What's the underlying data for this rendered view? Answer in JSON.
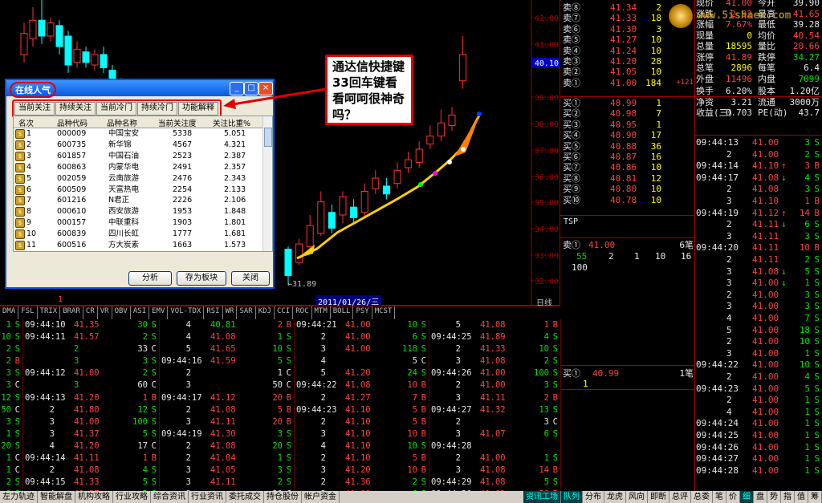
{
  "chart": {
    "price_labels": [
      "42.00",
      "41.00",
      "40.10",
      "39.00",
      "38.00",
      "37.00",
      "36.00",
      "35.00",
      "34.00",
      "33.00",
      "32.00"
    ],
    "low_marker": "←31.89",
    "date_label": "2011/01/26/三",
    "period_label": "日线",
    "marker_one": "1",
    "candles": [
      {
        "o": 40.6,
        "c": 41.4,
        "h": 41.8,
        "l": 40.3
      },
      {
        "o": 41.2,
        "c": 41.9,
        "h": 42.4,
        "l": 40.9
      },
      {
        "o": 41.9,
        "c": 41.3,
        "h": 42.7,
        "l": 41.0
      },
      {
        "o": 41.3,
        "c": 41.8,
        "h": 42.0,
        "l": 41.1
      },
      {
        "o": 41.7,
        "c": 40.9,
        "h": 41.9,
        "l": 40.6
      },
      {
        "o": 41.3,
        "c": 40.2,
        "h": 41.5,
        "l": 39.9
      },
      {
        "o": 40.3,
        "c": 40.8,
        "h": 41.1,
        "l": 40.1
      },
      {
        "o": 40.7,
        "c": 40.3,
        "h": 40.9,
        "l": 40.1
      },
      {
        "o": 40.2,
        "c": 40.6,
        "h": 40.8,
        "l": 40.0
      },
      {
        "o": 40.6,
        "c": 40.1,
        "h": 40.9,
        "l": 39.9
      },
      {
        "o": 40.0,
        "c": 39.6,
        "h": 40.2,
        "l": 39.4
      },
      {
        "o": 39.5,
        "c": 39.1,
        "h": 39.7,
        "l": 38.9
      }
    ],
    "candles2": [
      {
        "o": 33.2,
        "c": 32.2,
        "h": 33.3,
        "l": 31.89
      },
      {
        "o": 32.7,
        "c": 33.4,
        "h": 33.6,
        "l": 32.6
      },
      {
        "o": 33.3,
        "c": 34.1,
        "h": 34.5,
        "l": 33.1
      },
      {
        "o": 33.8,
        "c": 35.0,
        "h": 35.4,
        "l": 33.7
      },
      {
        "o": 34.6,
        "c": 34.0,
        "h": 34.9,
        "l": 33.8
      },
      {
        "o": 34.5,
        "c": 35.2,
        "h": 35.4,
        "l": 34.2
      },
      {
        "o": 34.8,
        "c": 34.4,
        "h": 35.1,
        "l": 34.2
      },
      {
        "o": 34.6,
        "c": 35.4,
        "h": 35.7,
        "l": 34.4
      },
      {
        "o": 35.5,
        "c": 35.9,
        "h": 36.2,
        "l": 35.3
      },
      {
        "o": 35.6,
        "c": 35.3,
        "h": 35.9,
        "l": 35.1
      },
      {
        "o": 35.7,
        "c": 36.2,
        "h": 36.5,
        "l": 35.5
      },
      {
        "o": 36.3,
        "c": 36.6,
        "h": 36.9,
        "l": 36.1
      },
      {
        "o": 36.5,
        "c": 37.0,
        "h": 37.3,
        "l": 36.3
      },
      {
        "o": 37.2,
        "c": 37.5,
        "h": 37.9,
        "l": 37.0
      },
      {
        "o": 37.5,
        "c": 38.0,
        "h": 38.5,
        "l": 37.3
      },
      {
        "o": 37.9,
        "c": 38.3,
        "h": 38.6,
        "l": 37.7
      },
      {
        "o": 39.6,
        "c": 40.6,
        "h": 41.3,
        "l": 39.3
      }
    ]
  },
  "indicators": [
    "DMA",
    "FSL",
    "TRIX",
    "BRAR",
    "CR",
    "VR",
    "OBV",
    "ASI",
    "EMV",
    "VOL-TDX",
    "RSI",
    "WR",
    "SAR",
    "KDJ",
    "CCI",
    "ROC",
    "MTM",
    "BOLL",
    "PSY",
    "MCST"
  ],
  "tick_cols": [
    [
      [
        "1",
        "S"
      ],
      [
        "10",
        "S"
      ],
      [
        "2",
        "S"
      ],
      [
        "2",
        "B"
      ],
      [
        "3",
        "S"
      ],
      [
        "3",
        "C"
      ],
      [
        "12",
        "S"
      ],
      [
        "50",
        "C"
      ],
      [
        "3",
        "S"
      ],
      [
        "1",
        "S"
      ],
      [
        "20",
        "S"
      ],
      [
        "1",
        "C"
      ],
      [
        "1",
        "C"
      ],
      [
        "2",
        "S"
      ],
      [
        "1",
        "S"
      ]
    ],
    [
      [
        "09:44:10",
        "41.35",
        "30",
        "S"
      ],
      [
        "09:44:11",
        "41.57",
        "2",
        "S"
      ],
      [
        "",
        "2",
        "33",
        "C"
      ],
      [
        "",
        "3",
        "3",
        "S"
      ],
      [
        "09:44:12",
        "41.00",
        "2",
        "S"
      ],
      [
        "",
        "3",
        "60",
        "C"
      ],
      [
        "09:44:13",
        "41.20",
        "1",
        "B"
      ],
      [
        "",
        "2",
        "41.80",
        "12",
        "S"
      ],
      [
        "",
        "3",
        "41.00",
        "100",
        "S"
      ],
      [
        "",
        "3",
        "41.37",
        "5",
        "S"
      ],
      [
        "",
        "4",
        "41.20",
        "17",
        "C"
      ],
      [
        "09:44:14",
        "41.11",
        "1",
        "B"
      ],
      [
        "",
        "2",
        "41.08",
        "4",
        "S"
      ],
      [
        "09:44:15",
        "41.33",
        "5",
        "S"
      ],
      [
        "",
        "4",
        "41.37",
        "2",
        "S"
      ]
    ],
    [
      [
        "",
        "4",
        "40.81",
        "2",
        "B"
      ],
      [
        "",
        "4",
        "41.08",
        "1",
        "S"
      ],
      [
        "",
        "5",
        "41.65",
        "10",
        "S"
      ],
      [
        "09:44:16",
        "41.59",
        "5",
        "S"
      ],
      [
        "",
        "2",
        "",
        "1",
        "C"
      ],
      [
        "",
        "3",
        "",
        "50",
        "C"
      ],
      [
        "09:44:17",
        "41.12",
        "20",
        "B"
      ],
      [
        "",
        "2",
        "41.08",
        "5",
        "B"
      ],
      [
        "",
        "3",
        "41.11",
        "20",
        "B"
      ],
      [
        "09:44:19",
        "41.30",
        "3",
        "S"
      ],
      [
        "",
        "2",
        "41.08",
        "20",
        "S"
      ],
      [
        "",
        "2",
        "41.04",
        "1",
        "S"
      ],
      [
        "",
        "3",
        "41.05",
        "3",
        "S"
      ],
      [
        "",
        "3",
        "41.11",
        "2",
        "S"
      ],
      [
        "",
        "3",
        "",
        "30",
        "C"
      ]
    ],
    [
      [
        "09:44:21",
        "41.00",
        "10",
        "S"
      ],
      [
        "",
        "2",
        "41.00",
        "6",
        "S"
      ],
      [
        "",
        "3",
        "41.00",
        "118",
        "S"
      ],
      [
        "",
        "4",
        "",
        "5",
        "C"
      ],
      [
        "",
        "5",
        "41.20",
        "24",
        "S"
      ],
      [
        "09:44:22",
        "41.08",
        "10",
        "B"
      ],
      [
        "",
        "2",
        "41.27",
        "7",
        "B"
      ],
      [
        "09:44:23",
        "41.10",
        "5",
        "B"
      ],
      [
        "",
        "2",
        "41.10",
        "5",
        "B"
      ],
      [
        "",
        "3",
        "41.10",
        "10",
        "B"
      ],
      [
        "",
        "4",
        "41.10",
        "10",
        "S"
      ],
      [
        "",
        "2",
        "41.10",
        "5",
        "B"
      ],
      [
        "",
        "3",
        "41.20",
        "10",
        "B"
      ],
      [
        "",
        "2",
        "41.36",
        "2",
        "S"
      ],
      [
        "",
        "3",
        "41.00",
        "6",
        "S"
      ]
    ],
    [
      [
        "",
        "5",
        "41.08",
        "1",
        "B"
      ],
      [
        "09:44:25",
        "41.89",
        "4",
        "S"
      ],
      [
        "",
        "2",
        "41.33",
        "10",
        "S"
      ],
      [
        "",
        "3",
        "41.08",
        "2",
        "S"
      ],
      [
        "09:44:26",
        "41.00",
        "100",
        "S"
      ],
      [
        "",
        "2",
        "41.00",
        "3",
        "S"
      ],
      [
        "",
        "3",
        "41.11",
        "2",
        "B"
      ],
      [
        "09:44:27",
        "41.32",
        "13",
        "S"
      ],
      [
        "",
        "2",
        "",
        "3",
        "C"
      ],
      [
        "",
        "3",
        "41.07",
        "6",
        "S"
      ],
      [
        "09:44:28",
        "",
        "",
        ""
      ],
      [
        "",
        "2",
        "41.00",
        "1",
        "S"
      ],
      [
        "",
        "3",
        "41.08",
        "14",
        "B"
      ],
      [
        "09:44:29",
        "41.08",
        "5",
        "S"
      ],
      [
        "09:44:30",
        "41.01",
        "20",
        "B"
      ]
    ]
  ],
  "orderbook": {
    "sells": [
      [
        "卖⑧",
        "41.34",
        "2"
      ],
      [
        "卖⑦",
        "41.33",
        "18"
      ],
      [
        "卖⑥",
        "41.30",
        "3"
      ],
      [
        "卖⑤",
        "41.27",
        "10"
      ],
      [
        "卖④",
        "41.24",
        "10"
      ],
      [
        "卖③",
        "41.20",
        "28"
      ],
      [
        "卖②",
        "41.05",
        "10"
      ],
      [
        "卖①",
        "41.00",
        "184",
        "+121"
      ]
    ],
    "buys": [
      [
        "买①",
        "40.99",
        "1"
      ],
      [
        "买②",
        "40.98",
        "7"
      ],
      [
        "买③",
        "40.95",
        "1"
      ],
      [
        "买④",
        "40.90",
        "17"
      ],
      [
        "买⑤",
        "40.88",
        "36"
      ],
      [
        "买⑥",
        "40.87",
        "16"
      ],
      [
        "买⑦",
        "40.86",
        "10"
      ],
      [
        "买⑧",
        "40.81",
        "12"
      ],
      [
        "买⑨",
        "40.80",
        "10"
      ],
      [
        "买⑩",
        "40.78",
        "10"
      ]
    ],
    "tsp": "TSP",
    "sell_detail_label": "卖①",
    "sell_detail_price": "41.00",
    "sell_detail_count": "6笔",
    "sell_detail_vols": [
      "55",
      "2",
      "1",
      "10",
      "16"
    ],
    "sell_detail_vol2": "100",
    "buy_detail_label": "买①",
    "buy_detail_price": "40.99",
    "buy_detail_count": "1笔",
    "buy_detail_vol": "1"
  },
  "stats": [
    [
      "现价",
      "41.00",
      "今开",
      "39.90"
    ],
    [
      "涨跌",
      "2.92",
      "最高",
      "41.65"
    ],
    [
      "涨幅",
      "7.67%",
      "最低",
      "39.28"
    ],
    [
      "现量",
      "0",
      "均价",
      "40.54"
    ],
    [
      "总量",
      "18595",
      "量比",
      "20.66"
    ],
    [
      "涨停",
      "41.89",
      "跌停",
      "34.27"
    ],
    [
      "总笔",
      "2896",
      "每笔",
      "6.4"
    ],
    [
      "外盘",
      "11496",
      "内盘",
      "7099"
    ],
    [
      "换手",
      "6.20%",
      "股本",
      "1.20亿"
    ],
    [
      "净资",
      "3.21",
      "流通",
      "3000万"
    ],
    [
      "收益(三)",
      "0.703",
      "PE(动)",
      "43.7"
    ]
  ],
  "right_ticks": [
    [
      "09:44:13",
      "41.00",
      "3",
      "S",
      ""
    ],
    [
      "",
      "2",
      "41.00",
      "2",
      "S"
    ],
    [
      "09:44:14",
      "41.10",
      "3",
      "B",
      "up"
    ],
    [
      "09:44:17",
      "41.08",
      "4",
      "S",
      "down"
    ],
    [
      "",
      "2",
      "41.08",
      "3",
      "S"
    ],
    [
      "",
      "3",
      "41.10",
      "1",
      "B"
    ],
    [
      "09:44:19",
      "41.12",
      "14",
      "B",
      "up"
    ],
    [
      "",
      "2",
      "41.11",
      "6",
      "S",
      "down"
    ],
    [
      "",
      "3",
      "41.11",
      "3",
      "S"
    ],
    [
      "09:44:20",
      "41.11",
      "10",
      "B"
    ],
    [
      "",
      "2",
      "41.11",
      "2",
      "S"
    ],
    [
      "",
      "3",
      "41.08",
      "5",
      "S",
      "down"
    ],
    [
      "",
      "3",
      "41.00",
      "1",
      "S",
      "down"
    ],
    [
      "",
      "2",
      "41.00",
      "3",
      "S"
    ],
    [
      "",
      "3",
      "41.00",
      "3",
      "S"
    ],
    [
      "",
      "4",
      "41.00",
      "7",
      "S"
    ],
    [
      "",
      "5",
      "41.00",
      "18",
      "S"
    ],
    [
      "",
      "2",
      "41.00",
      "10",
      "S"
    ],
    [
      "",
      "3",
      "41.00",
      "1",
      "S"
    ],
    [
      "09:44:22",
      "41.00",
      "10",
      "S"
    ],
    [
      "",
      "2",
      "41.00",
      "4",
      "S"
    ],
    [
      "09:44:23",
      "41.00",
      "5",
      "S"
    ],
    [
      "",
      "2",
      "41.00",
      "1",
      "S"
    ],
    [
      "",
      "4",
      "41.00",
      "1",
      "S"
    ],
    [
      "09:44:24",
      "41.00",
      "1",
      "S"
    ],
    [
      "09:44:25",
      "41.00",
      "1",
      "S"
    ],
    [
      "09:44:26",
      "41.00",
      "1",
      "S"
    ],
    [
      "09:44:27",
      "41.00",
      "1",
      "S"
    ],
    [
      "09:44:28",
      "41.00",
      "1",
      "S"
    ]
  ],
  "tabs": [
    "左力轨迹",
    "智能解盘",
    "机构攻略",
    "行业攻略",
    "综合资讯",
    "行业资讯",
    "委托成交",
    "持仓股份",
    "帐户资金",
    "",
    "资讯工场",
    "队列",
    "分布",
    "龙虎",
    "风向",
    "即断",
    "总评",
    "总委",
    "笔",
    "价",
    "细",
    "盘",
    "势",
    "指",
    "值",
    "筹"
  ],
  "dialog": {
    "title": "在线人气",
    "tabs": [
      "当前关注",
      "持续关注",
      "当前冷门",
      "持续冷门",
      "功能解释"
    ],
    "cols": [
      "名次",
      "品种代码",
      "品种名称",
      "当前关注度",
      "关注比重%"
    ],
    "rows": [
      [
        "1",
        "000009",
        "中国宝安",
        "5338",
        "5.051"
      ],
      [
        "2",
        "600735",
        "新华锦",
        "4567",
        "4.321"
      ],
      [
        "3",
        "601857",
        "中国石油",
        "2523",
        "2.387"
      ],
      [
        "4",
        "600863",
        "内蒙华电",
        "2491",
        "2.357"
      ],
      [
        "5",
        "002059",
        "云南旅游",
        "2476",
        "2.343"
      ],
      [
        "6",
        "600509",
        "天富热电",
        "2254",
        "2.133"
      ],
      [
        "7",
        "601216",
        "N君正",
        "2226",
        "2.106"
      ],
      [
        "8",
        "000610",
        "西安旅游",
        "1953",
        "1.848"
      ],
      [
        "9",
        "000157",
        "中联重科",
        "1903",
        "1.801"
      ],
      [
        "10",
        "600839",
        "四川长虹",
        "1777",
        "1.681"
      ],
      [
        "11",
        "600516",
        "方大炭素",
        "1663",
        "1.573"
      ]
    ],
    "btn_analyze": "分析",
    "btn_save": "存为板块",
    "btn_close": "关闭"
  },
  "note": "通达信快捷键33回车键看看呵呵很神奇吗？",
  "logo_text": "www.5ishaex.com"
}
